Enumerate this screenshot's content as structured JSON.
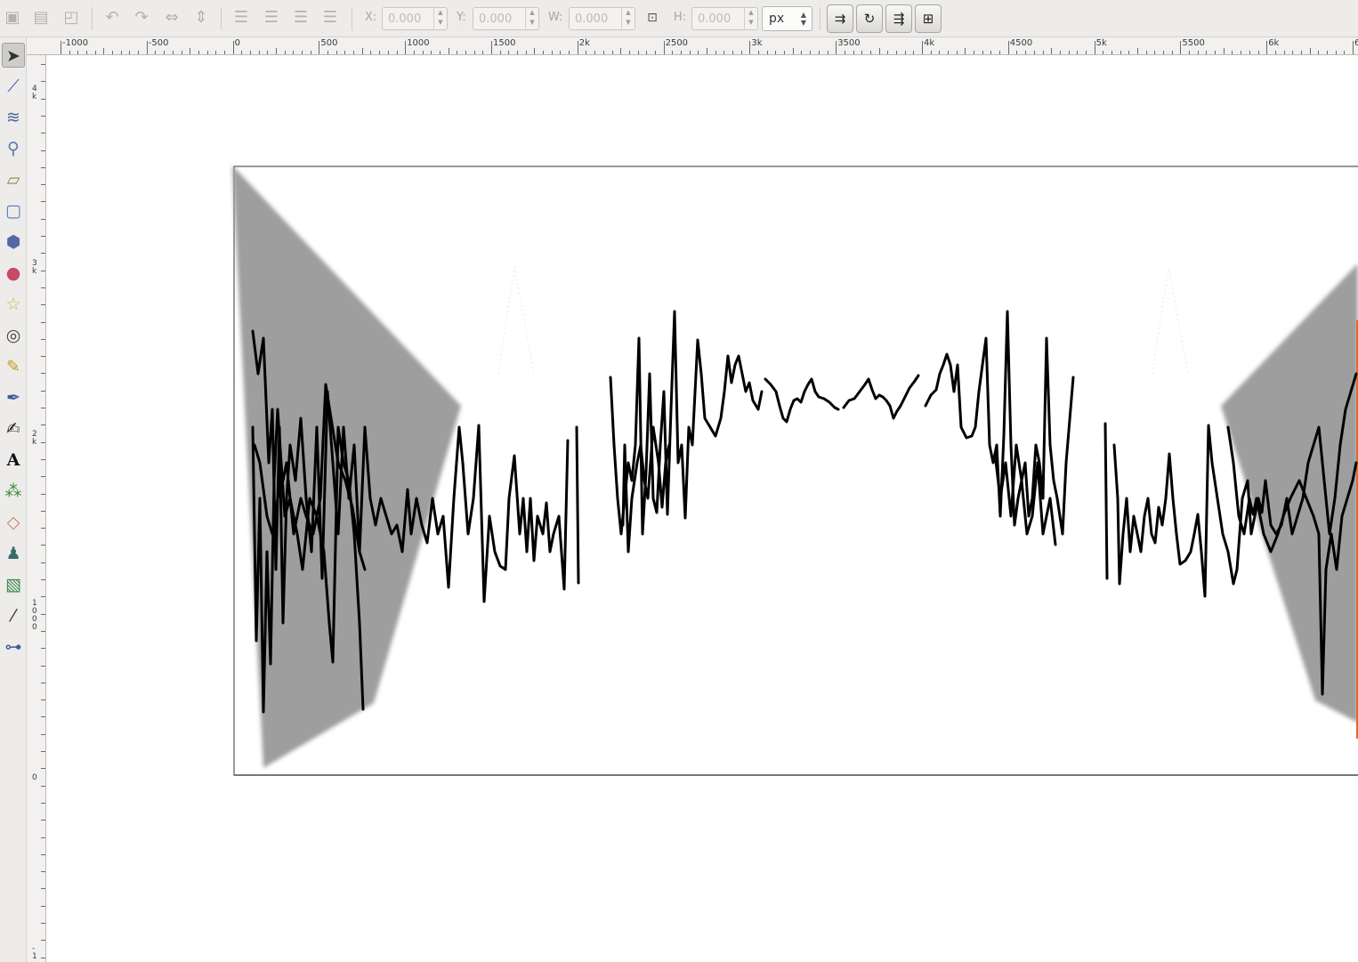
{
  "toolbar": {
    "x_label": "X:",
    "x_value": "0.000",
    "y_label": "Y:",
    "y_value": "0.000",
    "w_label": "W:",
    "w_value": "0.000",
    "h_label": "H:",
    "h_value": "0.000",
    "unit": "px"
  },
  "rulers": {
    "top_labels": [
      "-1000",
      "-500",
      "0",
      "500",
      "1000",
      "1500",
      "2k",
      "2500",
      "3k",
      "3500",
      "4k",
      "4500",
      "5k",
      "5500",
      "6k",
      "6"
    ],
    "left_labels": [
      "4\nk",
      "3\nk",
      "2\nk",
      "1\n0\n0\n0",
      "0",
      "-\n1"
    ]
  },
  "tools": [
    "selector-tool-icon",
    "node-tool-icon",
    "tweak-tool-icon",
    "zoom-tool-icon",
    "measure-tool-icon",
    "rectangle-tool-icon",
    "box3d-tool-icon",
    "ellipse-tool-icon",
    "star-tool-icon",
    "spiral-tool-icon",
    "pencil-tool-icon",
    "pen-tool-icon",
    "calligraphy-tool-icon",
    "text-tool-icon",
    "spray-tool-icon",
    "eraser-tool-icon",
    "paint-bucket-tool-icon",
    "gradient-tool-icon",
    "dropper-tool-icon",
    "connector-tool-icon"
  ],
  "colors": {
    "page_border": "#555555",
    "gray_panel": "#9e9e9e",
    "stroke": "#000000",
    "accent_edge": "#e8662b"
  }
}
